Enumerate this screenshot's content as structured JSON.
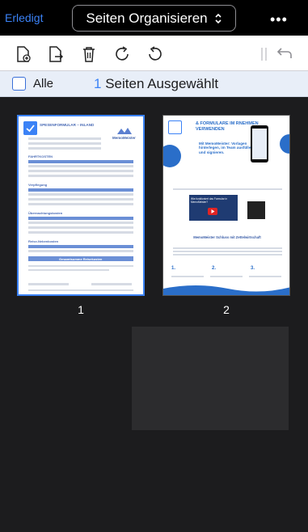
{
  "nav": {
    "done_label": "Erledigt",
    "title": "Seiten Organisieren",
    "title_chevron": "⌃⌄",
    "more_label": "•••"
  },
  "toolbar": {
    "icons": [
      "add-page-icon",
      "export-page-icon",
      "trash-icon",
      "rotate-right-icon",
      "rotate-left-icon",
      "split-icon",
      "undo-icon"
    ]
  },
  "selection": {
    "all_label": "Alle",
    "count": "1",
    "info_label": "Seiten Ausgewählt"
  },
  "pages": [
    {
      "number": "1",
      "selected": true,
      "heading": "SPESENFORMULAR – INLAND",
      "logo": "MemoMeister",
      "sections": [
        "FAHRTKOSTEN",
        "Verpflegung",
        "Übernachtungskosten",
        "Reise-Nebenkosten"
      ],
      "total_label": "Gesamtsumme Reisekosten"
    },
    {
      "number": "2",
      "selected": false,
      "heading": "& FORMULARE IM RNEHMEN VERWENDEN",
      "tagline": "Mit MemoMeister: Vorlagen hinterlegen, im Team ausfüllen und signieren.",
      "video_caption": "Wie funktioniert das Formular in MemoMeister?",
      "subheading": "MemoMeister Schluss mit Zettelwirtschaft",
      "steps": [
        "1.",
        "2.",
        "3."
      ]
    }
  ],
  "colors": {
    "accent": "#3b82f6",
    "top_bar": "#000000",
    "toolbar": "#ffffff",
    "selection_bar": "#e8eef8",
    "canvas": "#1c1c1e"
  }
}
